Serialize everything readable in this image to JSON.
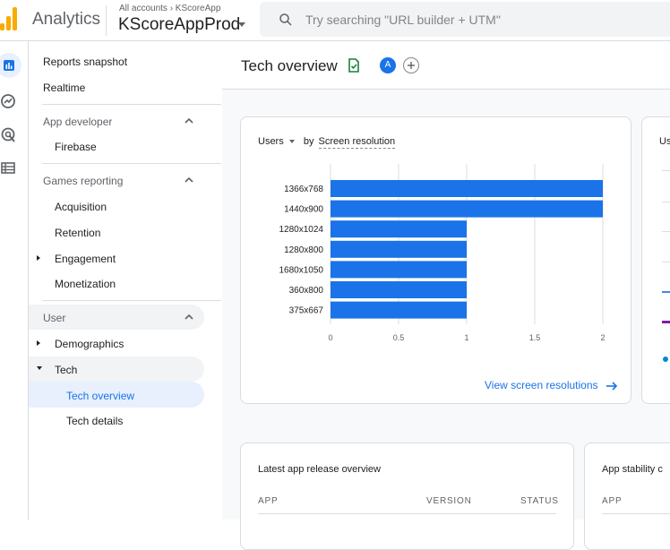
{
  "header": {
    "brand": "Analytics",
    "breadcrumb": "All accounts › KScoreApp",
    "property": "KScoreAppProd",
    "search_placeholder": "Try searching \"URL builder + UTM\""
  },
  "nav": {
    "reports_snapshot": "Reports snapshot",
    "realtime": "Realtime",
    "app_developer": "App developer",
    "firebase": "Firebase",
    "games_reporting": "Games reporting",
    "acquisition": "Acquisition",
    "retention": "Retention",
    "engagement": "Engagement",
    "monetization": "Monetization",
    "user": "User",
    "demographics": "Demographics",
    "tech": "Tech",
    "tech_overview": "Tech overview",
    "tech_details": "Tech details"
  },
  "page": {
    "title": "Tech overview",
    "avatar_letter": "A"
  },
  "resolution_card": {
    "metric": "Users",
    "by_prefix": "by",
    "dimension": "Screen resolution",
    "link": "View screen resolutions"
  },
  "partial_card": {
    "title": "Us"
  },
  "release_card": {
    "title": "Latest app release overview",
    "col_app": "APP",
    "col_version": "VERSION",
    "col_status": "STATUS"
  },
  "stability_card": {
    "title": "App stability c",
    "col_app": "APP"
  },
  "chart_data": {
    "type": "bar",
    "orientation": "horizontal",
    "categories": [
      "1366x768",
      "1440x900",
      "1280x1024",
      "1280x800",
      "1680x1050",
      "360x800",
      "375x667"
    ],
    "values": [
      2,
      2,
      1,
      1,
      1,
      1,
      1
    ],
    "xticks": [
      "0",
      "0.5",
      "1",
      "1.5",
      "2"
    ],
    "xlim": [
      0,
      2
    ],
    "grid": true,
    "color": "#1a73e8"
  },
  "colors": {
    "accent": "#1a73e8",
    "active_bg": "#e8f0fe",
    "brand": "#f9ab00"
  }
}
